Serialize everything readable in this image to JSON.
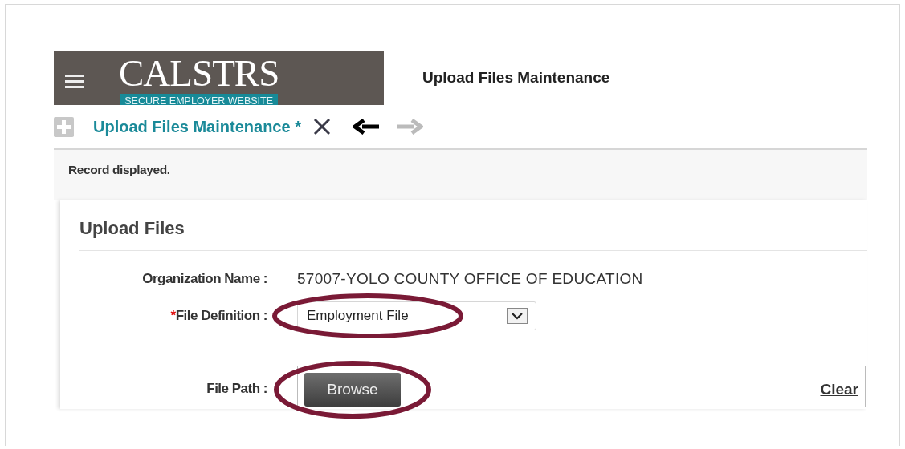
{
  "logo": {
    "title": "CALSTRS",
    "subtitle": "SECURE EMPLOYER WEBSITE"
  },
  "header": {
    "title": "Upload Files Maintenance"
  },
  "tab": {
    "label": "Upload Files Maintenance *",
    "back_enabled": true,
    "forward_enabled": false
  },
  "message": "Record displayed.",
  "panel": {
    "title": "Upload Files",
    "organization": {
      "label": "Organization Name :",
      "value": "57007-YOLO COUNTY OFFICE OF EDUCATION"
    },
    "file_definition": {
      "required_mark": "*",
      "label": "File Definition :",
      "value": "Employment File"
    },
    "file_path": {
      "label": "File Path :",
      "browse": "Browse",
      "clear": "Clear"
    }
  }
}
